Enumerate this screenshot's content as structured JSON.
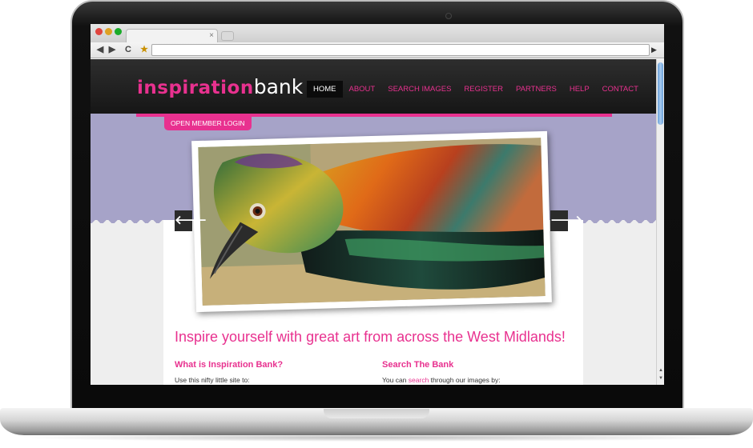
{
  "browser": {
    "tab_close": "×",
    "back": "◀",
    "forward": "▶",
    "reload": "C",
    "bookmark": "★",
    "go": "▶"
  },
  "site": {
    "logo_part1": "inspiration",
    "logo_part2": "bank",
    "nav": [
      {
        "label": "HOME",
        "active": true
      },
      {
        "label": "ABOUT"
      },
      {
        "label": "SEARCH IMAGES"
      },
      {
        "label": "REGISTER"
      },
      {
        "label": "PARTNERS"
      },
      {
        "label": "HELP"
      },
      {
        "label": "CONTACT"
      }
    ],
    "login_tab": "OPEN MEMBER LOGIN",
    "slider": {
      "prev": "🡐",
      "next": "🡒"
    },
    "tagline": "Inspire yourself with great art from across the West Midlands!",
    "left_col": {
      "heading": "What is Inspiration Bank?",
      "text": "Use this nifty little site to:"
    },
    "right_col": {
      "heading": "Search The Bank",
      "text_before": "You can ",
      "link": "search",
      "text_after": " through our images by:"
    }
  },
  "colors": {
    "accent": "#e8318f",
    "hero": "#a6a3c8",
    "header": "#1e1e1e"
  }
}
